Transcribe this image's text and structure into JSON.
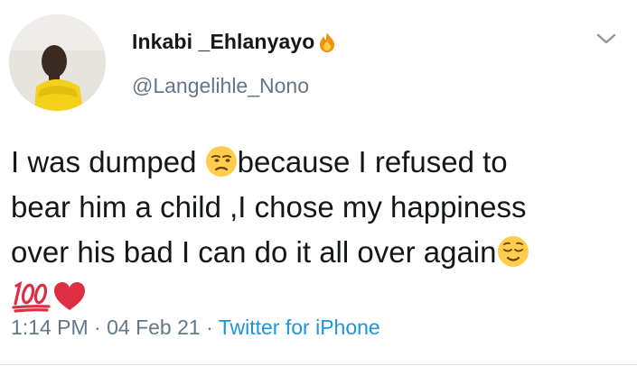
{
  "author": {
    "display_name": "Inkabi _Ehlanyayo",
    "handle": "@Langelihle_Nono",
    "name_emoji": "fire-icon"
  },
  "tweet": {
    "line1_before": "I was dumped ",
    "line1_after": "because I refused to",
    "line2": "bear him a child ,I chose my happiness",
    "line3": "over his bad I can do it all over again",
    "emojis": [
      "unamused-face-icon",
      "relieved-face-icon",
      "hundred-points-icon",
      "red-heart-icon"
    ]
  },
  "meta": {
    "time": "1:14 PM",
    "sep1": " · ",
    "date": "04 Feb 21",
    "sep2": " · ",
    "source": "Twitter for iPhone"
  },
  "colors": {
    "text": "#14171a",
    "secondary": "#657786",
    "link": "#1b95e0",
    "heart": "#dd2e44"
  }
}
